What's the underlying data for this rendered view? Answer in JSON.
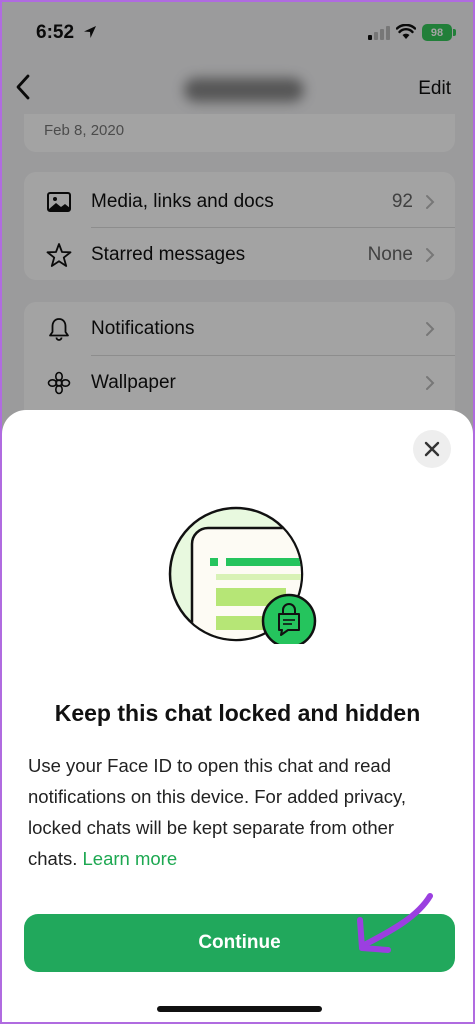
{
  "status_bar": {
    "time": "6:52",
    "battery": "98"
  },
  "nav": {
    "edit_label": "Edit"
  },
  "info": {
    "date": "Feb 8, 2020"
  },
  "rows": [
    {
      "label": "Media, links and docs",
      "value": "92"
    },
    {
      "label": "Starred messages",
      "value": "None"
    },
    {
      "label": "Notifications",
      "value": ""
    },
    {
      "label": "Wallpaper",
      "value": ""
    }
  ],
  "sheet": {
    "title": "Keep this chat locked and hidden",
    "body": "Use your Face ID to open this chat and read notifications on this device. For added privacy, locked chats will be kept separate from other chats. ",
    "learn_more": "Learn more",
    "continue_label": "Continue"
  },
  "colors": {
    "accent_green": "#21a85c",
    "link_green": "#1da851",
    "annotation_arrow": "#9b3fe0"
  },
  "icons": [
    "location-arrow-icon",
    "signal-icon",
    "wifi-icon",
    "battery-icon",
    "back-chevron-icon",
    "image-icon",
    "star-icon",
    "bell-icon",
    "flower-icon",
    "chevron-right-icon",
    "close-icon",
    "lock-chat-illustration",
    "annotation-arrow"
  ]
}
